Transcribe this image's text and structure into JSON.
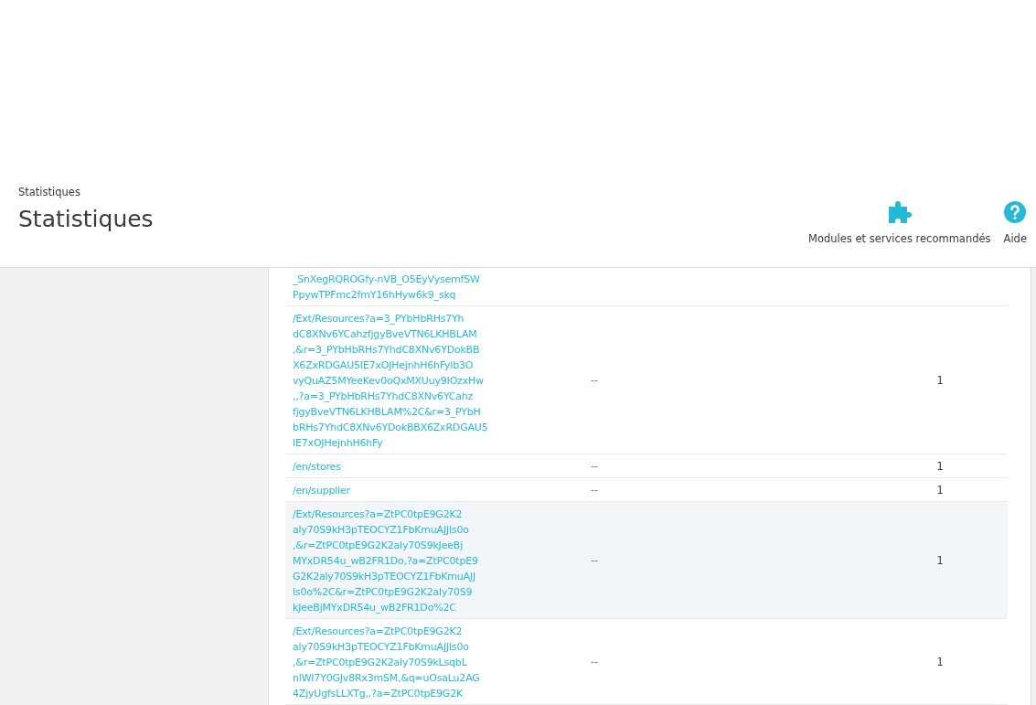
{
  "header": {
    "breadcrumb": "Statistiques",
    "title": "Statistiques",
    "toolbar": [
      {
        "kind": "modules",
        "label": "Modules et services recommandés"
      },
      {
        "kind": "help",
        "label": "Aide"
      }
    ]
  },
  "table": {
    "rows": [
      {
        "page": [
          "_SnXegRQROGfy-nVB_O5EyVysemfSW",
          "PpywTPFmc2fmY16hHyw6k9_skq"
        ],
        "selected": false
      },
      {
        "page": [
          "/Ext/Resources?a=3_PYbHbRHs7Yh",
          "dC8XNv6YCahzfjgyBveVTN6LKHBLAM",
          ",&r=3_PYbHbRHs7YhdC8XNv6YDokBB",
          "X6ZxRDGAU5IE7xOJHejnhH6hFylb3O",
          "vyQuAZ5MYeeKev0oQxMXUuy9IOzxHw",
          ",,?a=3_PYbHbRHs7YhdC8XNv6YCahz",
          "fjgyBveVTN6LKHBLAM%2C&r=3_PYbH",
          "bRHs7YhdC8XNv6YDokBBX6ZxRDGAU5",
          "IE7xOJHejnhH6hFy"
        ],
        "column_2": "--",
        "column_3": "1",
        "selected": false
      },
      {
        "page": [
          "/en/stores"
        ],
        "column_2": "--",
        "column_3": "1",
        "selected": false
      },
      {
        "page": [
          "/en/supplier"
        ],
        "column_2": "--",
        "column_3": "1",
        "selected": false
      },
      {
        "page": [
          "/Ext/Resources?a=ZtPC0tpE9G2K2",
          "aly70S9kH3pTEOCYZ1FbKmuAJJls0o",
          ",&r=ZtPC0tpE9G2K2aly70S9kJeeBj",
          "MYxDR54u_wB2FR1Do,?a=ZtPC0tpE9",
          "G2K2aly70S9kH3pTEOCYZ1FbKmuAJJ",
          "ls0o%2C&r=ZtPC0tpE9G2K2aly70S9",
          "kJeeBjMYxDR54u_wB2FR1Do%2C"
        ],
        "column_2": "--",
        "column_3": "1",
        "selected": true
      },
      {
        "page": [
          "/Ext/Resources?a=ZtPC0tpE9G2K2",
          "aly70S9kH3pTEOCYZ1FbKmuAJJls0o",
          ",&r=ZtPC0tpE9G2K2aly70S9kLsqbL",
          "nlWI7Y0GJv8Rx3mSM,&q=uOsaLu2AG",
          "4ZjyUgfsLLXTg,,?a=ZtPC0tpE9G2K"
        ],
        "column_2": "--",
        "column_3": "1",
        "selected": false
      }
    ]
  }
}
